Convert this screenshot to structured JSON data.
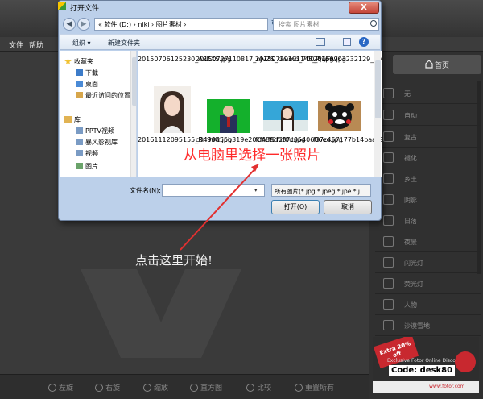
{
  "app": {
    "menu": [
      "文件",
      "帮助"
    ],
    "home_label": "首页",
    "effects": [
      "无",
      "自动",
      "复古",
      "褪化",
      "乡土",
      "阴影",
      "日落",
      "夜景",
      "闪光灯",
      "荧光灯",
      "人物",
      "沙漠雪地"
    ],
    "bottom_buttons": [
      "左旋",
      "右旋",
      "缩放",
      "直方图",
      "比较",
      "重置所有"
    ],
    "ad": {
      "ribbon": "Extra 20% off",
      "ribbon_sub": "Limited time offer",
      "line": "Exclusive Fotor Online Discount",
      "code": "Code: desk80",
      "url": "www.fotor.com"
    }
  },
  "dialog": {
    "title": "打开文件",
    "close_label": "X",
    "address": "« 软件 (D:) › niki › 图片素材 ›",
    "search_placeholder": "搜索 图片素材",
    "toolbar": {
      "organize": "组织 ▾",
      "new_folder": "新建文件夹"
    },
    "nav_items": [
      "收藏夹",
      "下载",
      "桌面",
      "最近访问的位置",
      "库",
      "PPTV视频",
      "暴风影视库",
      "视频",
      "图片"
    ],
    "files_row1": [
      "20150706125230_AxKXS.jpg",
      "20150727110817_nJvZS_thumb_700_0.jpg",
      "20150729101145_PjwFA.jpg",
      "20150903232129_SMVQc.jpg"
    ],
    "files_row2": [
      "20161112095155_RmhKt.jpg",
      "c3490655b319e20cffcff2f2f0d.jpg",
      "f0489db87c0540606ee.jpg",
      "f37c457177b14baa_97a2a00240_th.gif"
    ],
    "filename_label": "文件名(N):",
    "filename_value": "",
    "filetype_value": "所有图片(*.jpg *.jpeg *.jpe *.j",
    "open_label": "打开(O)",
    "cancel_label": "取消"
  },
  "annotations": {
    "select_hint": "从电脑里选择一张照片",
    "click_hint": "点击这里开始!"
  }
}
